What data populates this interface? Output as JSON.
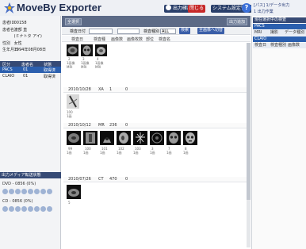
{
  "header": {
    "title_part1": "MoveBy Exporter",
    "title_part2": "",
    "buttons": {
      "send": "出力確認",
      "close": "閉じる",
      "system": "システム設定管理",
      "help": "?"
    },
    "accent": "#1f2d50"
  },
  "right_top": {
    "line1": "[パス] 1/データ出力",
    "line2": "1 出力作業"
  },
  "patient": {
    "fields": [
      {
        "k": "患者ID",
        "v": "00158"
      },
      {
        "k": "患者名",
        "v": "渡部 直"
      },
      {
        "k": "",
        "v": "(ミナトタ アイ)"
      },
      {
        "k": "性別",
        "v": "女性"
      },
      {
        "k": "生年月日",
        "v": "1994年08月08日"
      }
    ],
    "table": {
      "headers": [
        "区分",
        "患者名",
        "状態"
      ],
      "rows": [
        [
          "PACS",
          "01",
          "取得済"
        ],
        [
          "CLAIO",
          "01",
          "取得済"
        ]
      ]
    }
  },
  "media": {
    "title": "出力メディア転送状態",
    "items": [
      {
        "label": "DVD - 0856 (0%)"
      },
      {
        "label": "CD - 0856 (0%)"
      }
    ]
  },
  "toolbar": {
    "btn_all": "全選択",
    "btn_right": "出力追加"
  },
  "search": {
    "label1": "検査日付",
    "label2": "検査種別",
    "select_value": "ALL",
    "btn_search": "検索",
    "btn_sort": "全画像へ切替"
  },
  "columns": [
    "検査日",
    "検査種",
    "画像数",
    "画像枚数",
    "部位",
    "検査名"
  ],
  "studies": [
    {
      "date": "",
      "modality": "",
      "count": "",
      "series": [
        {
          "no": "2",
          "cap1": "1画像",
          "cap2": "MRI"
        },
        {
          "no": "3",
          "cap1": "1画像",
          "cap2": "MRI"
        },
        {
          "no": "4",
          "cap1": "1画像",
          "cap2": "MRI"
        }
      ]
    },
    {
      "date": "2010/10/28",
      "modality": "XA",
      "count": "1",
      "count2": "0",
      "series": [
        {
          "no": "100",
          "cap1": "1画",
          "cap2": ""
        }
      ]
    },
    {
      "date": "2010/10/12",
      "modality": "MR",
      "count": "236",
      "count2": "0",
      "series": [
        {
          "no": "99",
          "cap1": "1画",
          "cap2": ""
        },
        {
          "no": "100",
          "cap1": "1画",
          "cap2": ""
        },
        {
          "no": "101",
          "cap1": "1画",
          "cap2": ""
        },
        {
          "no": "102",
          "cap1": "1画",
          "cap2": ""
        },
        {
          "no": "103",
          "cap1": "1画",
          "cap2": ""
        },
        {
          "no": "3",
          "cap1": "1画",
          "cap2": ""
        },
        {
          "no": "7",
          "cap1": "1画",
          "cap2": ""
        },
        {
          "no": "8",
          "cap1": "1画",
          "cap2": ""
        }
      ]
    },
    {
      "date": "2010/07/26",
      "modality": "CT",
      "count": "470",
      "count2": "0",
      "series": [
        {
          "no": "5",
          "cap1": "",
          "cap2": ""
        }
      ]
    }
  ],
  "right_panel": {
    "title": "現在選択中の検査",
    "rows": [
      {
        "label": "PACS",
        "c1": "",
        "c2": ""
      },
      {
        "label": "MRI",
        "c1": "撮影",
        "c2": "データ種別"
      },
      {
        "label": "CLAIO",
        "c1": "",
        "c2": ""
      },
      {
        "label": "検査日",
        "c1": "検査種別",
        "c2": "画像数"
      }
    ]
  }
}
